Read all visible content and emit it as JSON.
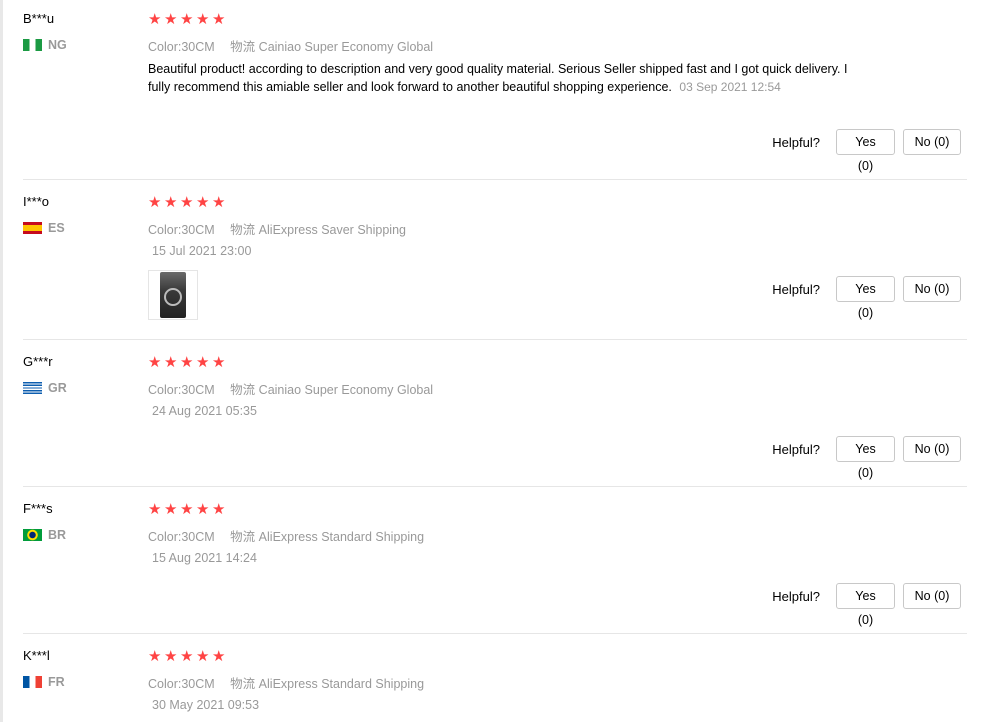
{
  "labels": {
    "color": "Color:",
    "shipping": "物流",
    "helpful": "Helpful?"
  },
  "colors": {
    "star": "#ff4747",
    "muted": "#999999"
  },
  "reviews": [
    {
      "user": "B***u",
      "country": "NG",
      "flag": "flag-nigeria",
      "rating": 5,
      "color_value": "30CM",
      "shipping": "Cainiao Super Economy Global",
      "text": "Beautiful product! according to description and very good quality material. Serious Seller shipped fast and I got quick delivery. I fully recommend this amiable seller and look forward to another beautiful shopping experience.",
      "date": "03 Sep 2021 12:54",
      "yes": "Yes (0)",
      "no": "No (0)"
    },
    {
      "user": "I***o",
      "country": "ES",
      "flag": "flag-spain",
      "rating": 5,
      "color_value": "30CM",
      "shipping": "AliExpress Saver Shipping",
      "text": "",
      "date": "15 Jul 2021 23:00",
      "yes": "Yes (0)",
      "no": "No (0)"
    },
    {
      "user": "G***r",
      "country": "GR",
      "flag": "flag-greece",
      "rating": 5,
      "color_value": "30CM",
      "shipping": "Cainiao Super Economy Global",
      "text": "",
      "date": "24 Aug 2021 05:35",
      "yes": "Yes (0)",
      "no": "No (0)"
    },
    {
      "user": "F***s",
      "country": "BR",
      "flag": "flag-brazil",
      "rating": 5,
      "color_value": "30CM",
      "shipping": "AliExpress Standard Shipping",
      "text": "",
      "date": "15 Aug 2021 14:24",
      "yes": "Yes (0)",
      "no": "No (0)"
    },
    {
      "user": "K***l",
      "country": "FR",
      "flag": "flag-france",
      "rating": 5,
      "color_value": "30CM",
      "shipping": "AliExpress Standard Shipping",
      "text": "",
      "date": "30 May 2021 09:53"
    }
  ]
}
